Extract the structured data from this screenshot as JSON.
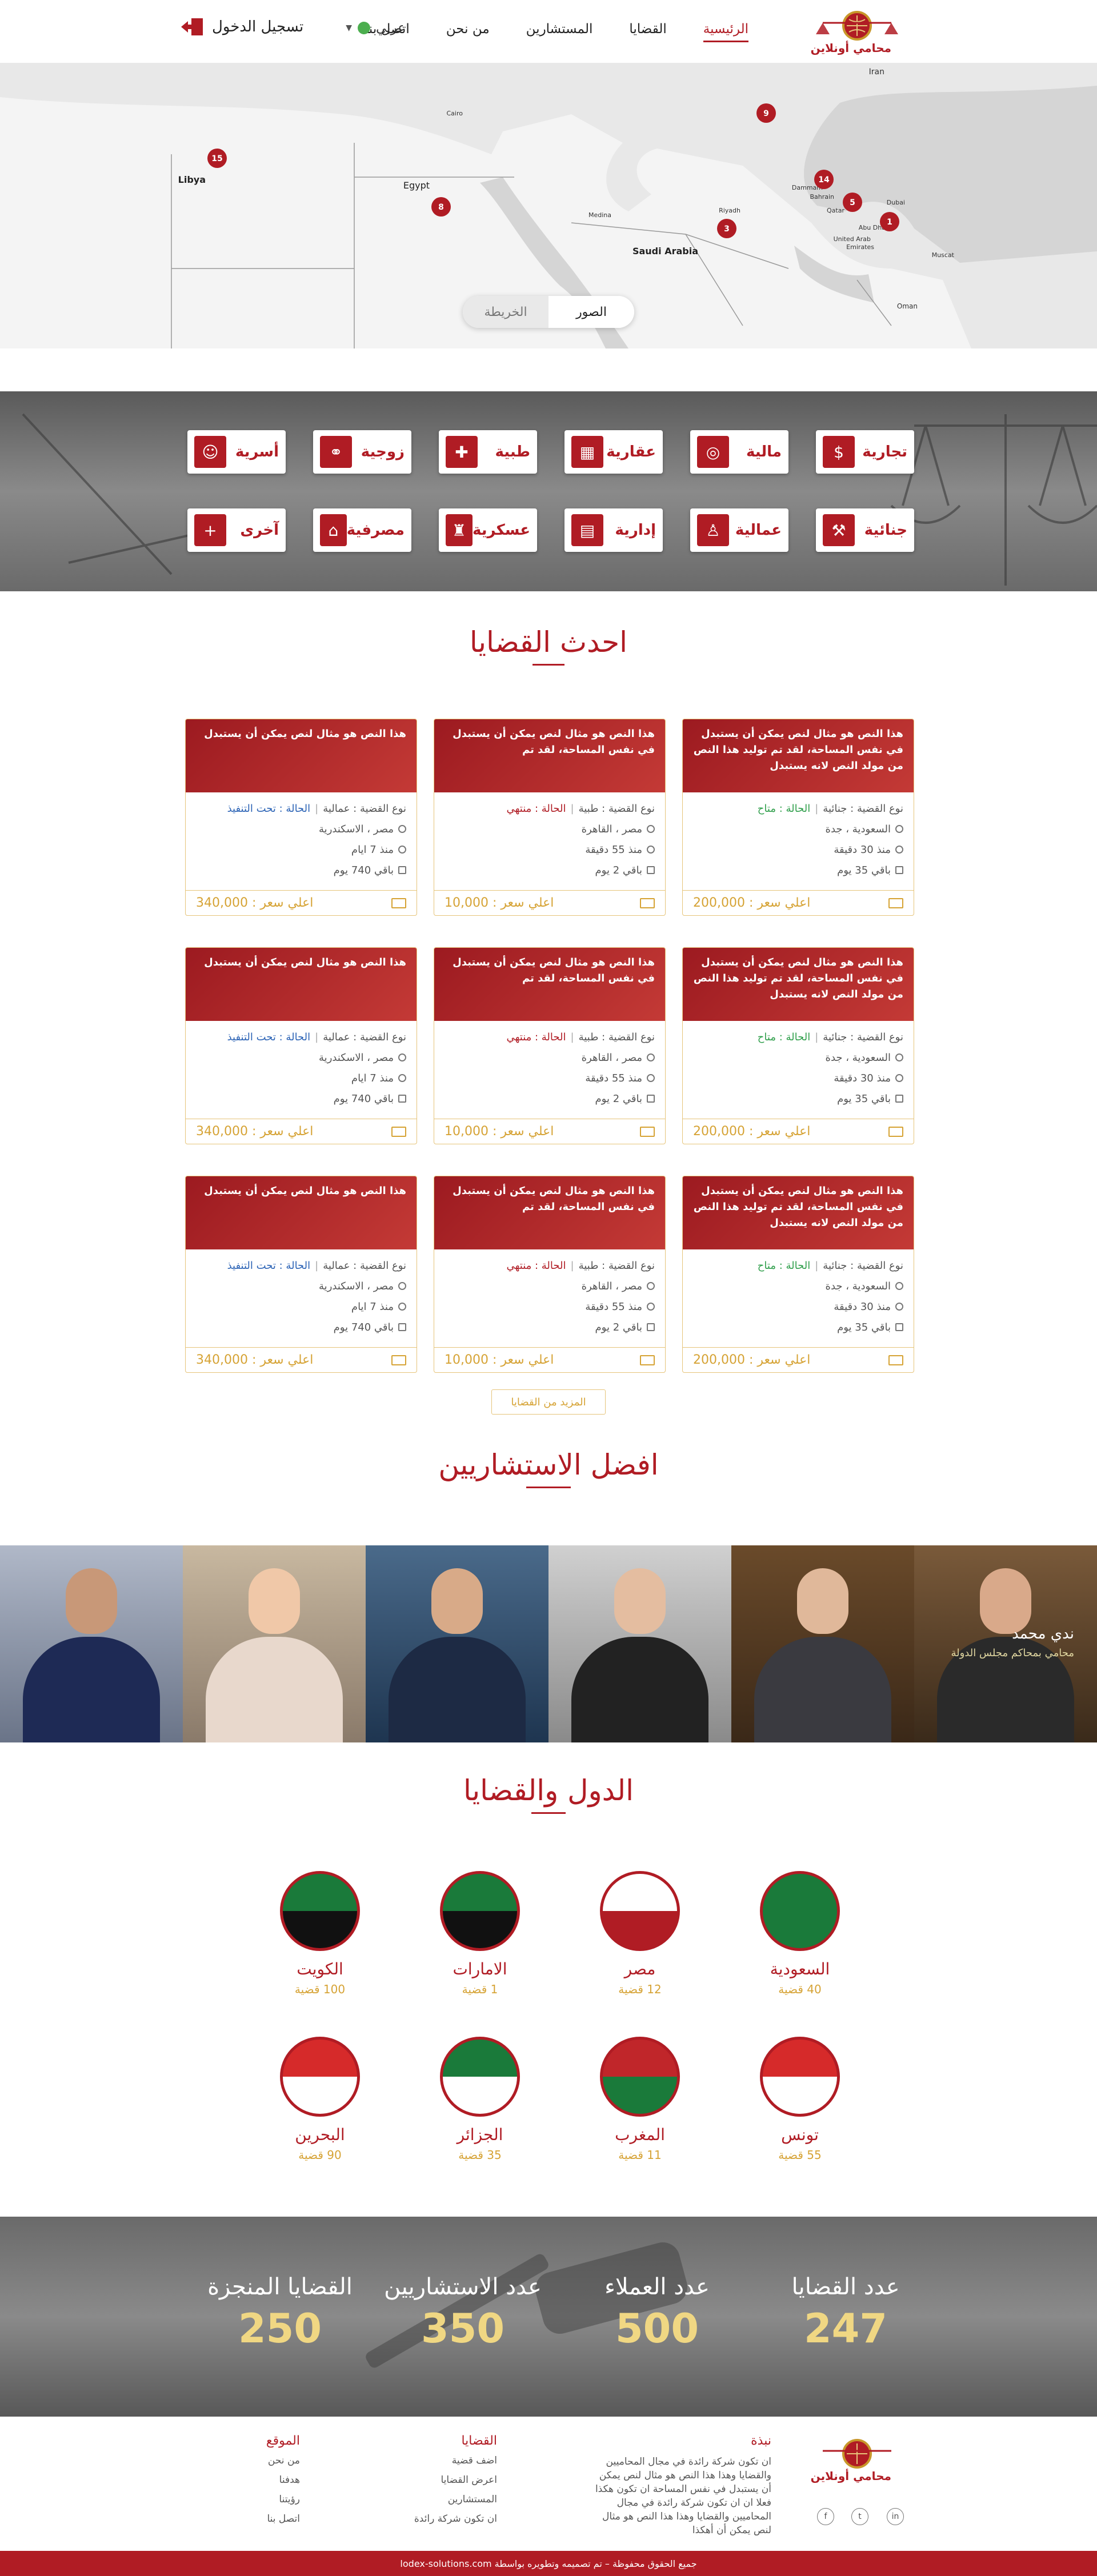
{
  "header": {
    "logo_text": "محامي أونلاين",
    "nav": [
      "الرئيسية",
      "القضايا",
      "المستشارين",
      "من نحن",
      "اتصل بنا"
    ],
    "lang": "عربي",
    "login": "تسجيل الدخول"
  },
  "map": {
    "labels": [
      "Iran",
      "Libya",
      "Egypt",
      "Saudi Arabia",
      "Qatar",
      "United Arab Emirates",
      "Oman",
      "Bahrain",
      "Cairo",
      "Medina",
      "Riyadh",
      "Abu Dhabi",
      "Muscat",
      "Dammam",
      "Dubai"
    ],
    "markers": [
      "15",
      "8",
      "9",
      "3",
      "14",
      "5",
      "1"
    ],
    "toggle": {
      "images": "الصور",
      "map": "الخريطة"
    }
  },
  "categories": [
    {
      "label": "تجارية",
      "icon": "money-bag-icon"
    },
    {
      "label": "مالية",
      "icon": "coins-icon"
    },
    {
      "label": "عقارية",
      "icon": "building-icon"
    },
    {
      "label": "طبية",
      "icon": "medical-bag-icon"
    },
    {
      "label": "زوجية",
      "icon": "couple-icon"
    },
    {
      "label": "أسرية",
      "icon": "family-icon"
    },
    {
      "label": "جنائية",
      "icon": "handcuff-icon"
    },
    {
      "label": "عمالية",
      "icon": "worker-icon"
    },
    {
      "label": "إدارية",
      "icon": "documents-icon"
    },
    {
      "label": "عسكرية",
      "icon": "soldier-icon"
    },
    {
      "label": "مصرفية",
      "icon": "bank-icon"
    },
    {
      "label": "آخرى",
      "icon": "plus-icon"
    }
  ],
  "latest_title": "احدث القضايا",
  "cases": [
    {
      "title": "هذا النص هو مثال لنص يمكن أن يستبدل في نفس المساحة، لقد تم توليد هذا النص من مولد النص لانه يستبدل",
      "type": "نوع القضية : جنائية",
      "status": "الحالة : متاح",
      "status_class": "status-ok",
      "location": "السعودية ، جدة",
      "time": "منذ 30 دقيقة",
      "remaining": "باقي 35 يوم",
      "price": "اعلي سعر : 200,000"
    },
    {
      "title": "هذا النص هو مثال لنص يمكن أن يستبدل في نفس المساحة، لقد تم",
      "type": "نوع القضية : طبية",
      "status": "الحالة : منتهي",
      "status_class": "status-done",
      "location": "مصر ، القاهرة",
      "time": "منذ 55 دقيقة",
      "remaining": "باقي 2 يوم",
      "price": "اعلي سعر : 10,000"
    },
    {
      "title": "هذا النص هو مثال لنص يمكن أن يستبدل",
      "type": "نوع القضية : عمالية",
      "status": "الحالة : تحت التنفيذ",
      "status_class": "status-prog",
      "location": "مصر ، الاسكندرية",
      "time": "منذ 7 ايام",
      "remaining": "باقي 740 يوم",
      "price": "اعلي سعر : 340,000"
    }
  ],
  "more_button": "المزيد من القضايا",
  "consultants_title": "افضل الاستشاريين",
  "consultants": [
    {
      "name": "ندي محمد",
      "role": "محامي بمحاكم مجلس الدولة"
    }
  ],
  "countries_title": "الدول والقضايا",
  "countries": [
    {
      "name": "السعودية",
      "count": "40 قضية"
    },
    {
      "name": "مصر",
      "count": "12 قضية"
    },
    {
      "name": "الامارات",
      "count": "1 قضية"
    },
    {
      "name": "الكويت",
      "count": "100 قضية"
    },
    {
      "name": "تونس",
      "count": "55 قضية"
    },
    {
      "name": "المغرب",
      "count": "11 قضية"
    },
    {
      "name": "الجزائر",
      "count": "35 قضية"
    },
    {
      "name": "البحرين",
      "count": "90 قضية"
    }
  ],
  "stats": [
    {
      "label": "عدد القضايا",
      "value": "247"
    },
    {
      "label": "عدد العملاء",
      "value": "500"
    },
    {
      "label": "عدد الاستشاريين",
      "value": "350"
    },
    {
      "label": "القضايا المنجزة",
      "value": "250"
    }
  ],
  "footer": {
    "about_title": "نبذة",
    "about_text": "ان تكون شركة رائدة في مجال المحاميين والقضايا وهذا هذا النص هو مثال لنص يمكن أن يستبدل في نفس المساحة ان تكون هكذا فعلا ان ان تكون شركة رائدة في مجال المحاميين والقضايا وهذا هذا النص هو مثال لنص يمكن أن أهكذا",
    "cases_title": "القضايا",
    "cases_links": [
      "اضف قضية",
      "اعرض القضايا",
      "المستشارين",
      "ان تكون شركة رائدة"
    ],
    "site_title": "الموقع",
    "site_links": [
      "من نحن",
      "هدفنا",
      "رؤيتنا",
      "اتصل بنا"
    ],
    "copyright": "جميع الحقوق محفوظة – تم تصميمه وتطويره بواسطة lodex-solutions.com"
  }
}
